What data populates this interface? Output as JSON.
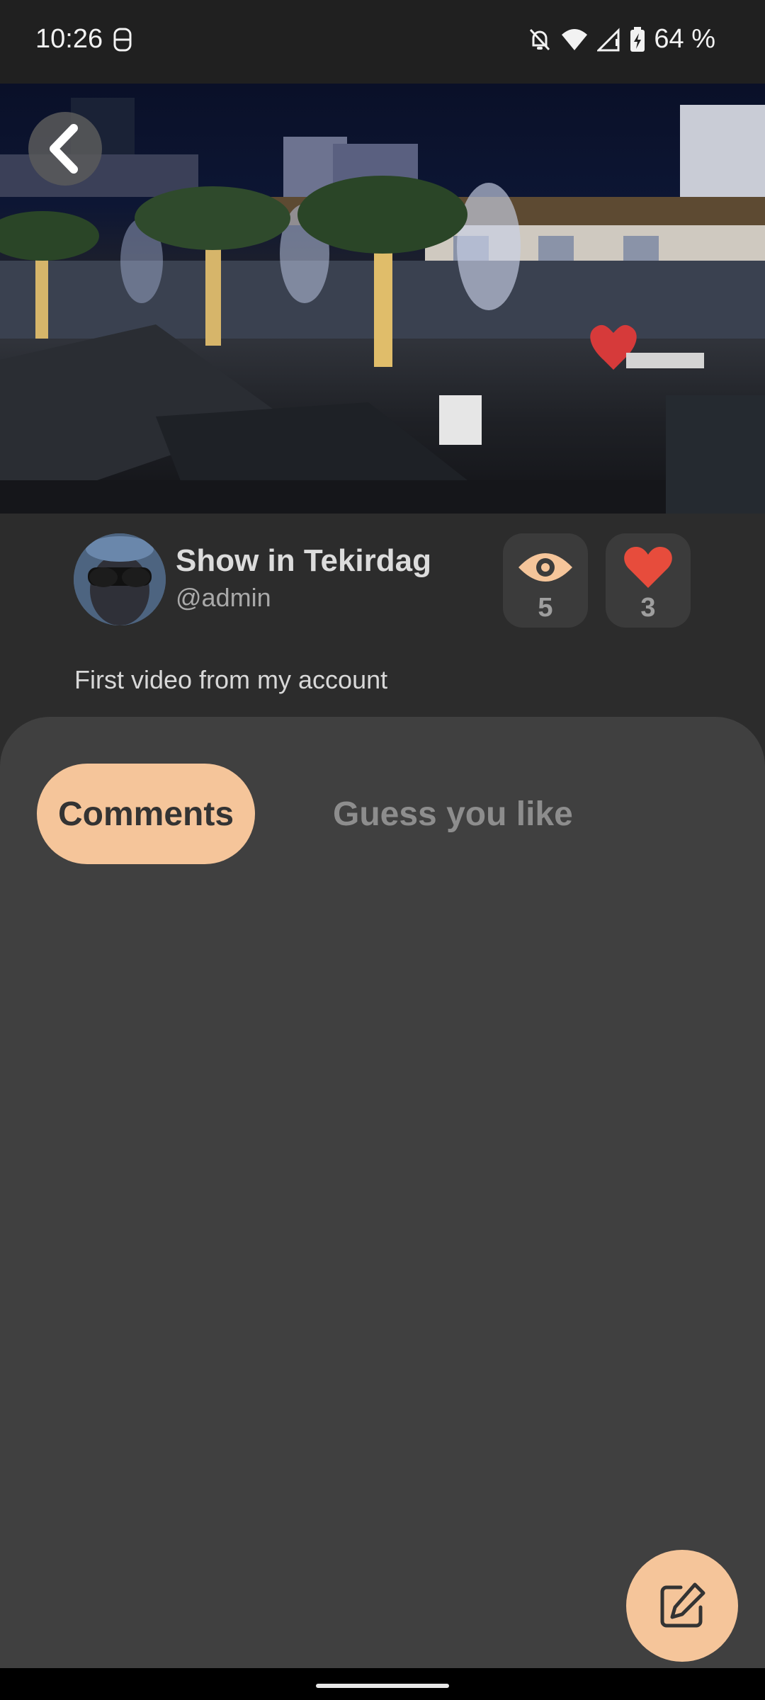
{
  "status_bar": {
    "time": "10:26",
    "battery": "64 %",
    "icons": [
      "screen-record-icon",
      "notifications-off-icon",
      "wifi-icon",
      "signal-icon",
      "battery-charging-icon"
    ]
  },
  "video": {
    "description": "Night scene of illuminated fountains and palm trees at a waterfront mall",
    "back_icon": "chevron-left-icon"
  },
  "post": {
    "title": "Show in Tekirdag",
    "handle": "@admin",
    "description": "First video from my account",
    "views": "5",
    "likes": "3"
  },
  "tabs": [
    {
      "label": "Comments",
      "active": true
    },
    {
      "label": "Guess you like",
      "active": false
    }
  ],
  "fab": {
    "icon": "edit-icon"
  },
  "colors": {
    "accent": "#f5c59a",
    "like": "#e74c3c",
    "sheet_bg": "#404040",
    "page_bg": "#2c2c2c"
  }
}
